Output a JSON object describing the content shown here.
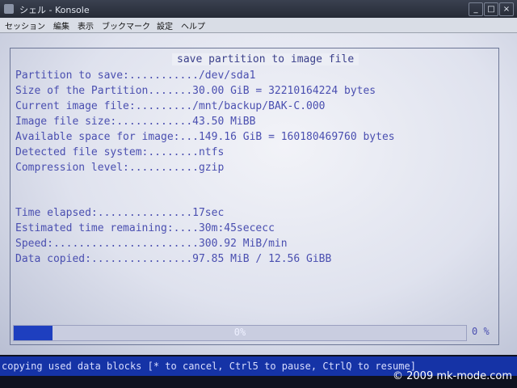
{
  "window": {
    "title": "シェル - Konsole",
    "minimize_glyph": "_",
    "maximize_glyph": "□",
    "close_glyph": "×"
  },
  "menu": [
    "セッション",
    "編集",
    "表示",
    "ブックマーク",
    "設定",
    "ヘルプ"
  ],
  "dialog": {
    "title": "save partition to image file",
    "rows": [
      "Partition to save:.........../dev/sda1",
      "Size of the Partition.......30.00 GiB = 32210164224 bytes",
      "Current image file:........./mnt/backup/BAK-C.000",
      "Image file size:............43.50 MiBB",
      "Available space for image:...149.16 GiB = 160180469760 bytes",
      "Detected file system:........ntfs",
      "Compression level:...........gzip",
      "Time elapsed:...............17sec",
      "Estimated time remaining:....30m:45sececc",
      "Speed:.......................300.92 MiB/min",
      "Data copied:................97.85 MiB / 12.56 GiBB"
    ]
  },
  "progress": {
    "value": 0.085,
    "bar_label": "0%",
    "percent_label": "0 %"
  },
  "status_text": "copying used data blocks [* to cancel, Ctrl5 to pause, CtrlQ to resume]",
  "copyright": "© 2009 mk-mode.com"
}
